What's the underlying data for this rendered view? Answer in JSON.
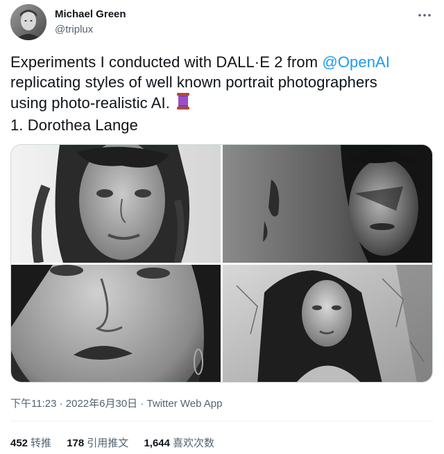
{
  "author": {
    "display_name": "Michael Green",
    "handle": "@triplux"
  },
  "tweet": {
    "line1_text": "Experiments I conducted with DALL·E 2 from ",
    "line1_mention": "@OpenAI",
    "line2": "replicating styles of well known portrait photographers",
    "line3": "using photo-realistic AI.",
    "line4": "1. Dorothea Lange",
    "emoji_icon": "thread-spool-icon"
  },
  "meta": {
    "time": "下午11:23",
    "separator1": " · ",
    "date": "2022年6月30日",
    "separator2": " · ",
    "source": "Twitter Web App"
  },
  "stats": [
    {
      "count": "452",
      "label": "转推"
    },
    {
      "count": "178",
      "label": "引用推文"
    },
    {
      "count": "1,644",
      "label": "喜欢次数"
    }
  ],
  "colors": {
    "link": "#1d9bf0",
    "secondary_text": "#536471",
    "primary_text": "#0f1419",
    "border": "#cfd9de"
  }
}
